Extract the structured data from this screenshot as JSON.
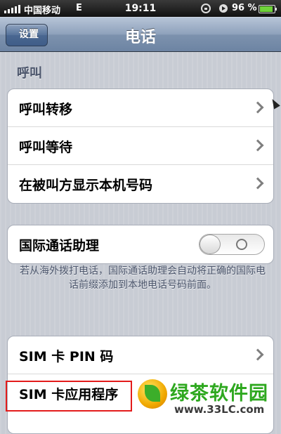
{
  "status_bar": {
    "carrier": "中国移动",
    "network": "E",
    "time": "19:11",
    "battery": "96 %"
  },
  "nav": {
    "back_label": "设置",
    "title": "电话"
  },
  "call_section": {
    "header": "呼叫",
    "items": [
      {
        "label": "呼叫转移"
      },
      {
        "label": "呼叫等待"
      },
      {
        "label": "在被叫方显示本机号码"
      }
    ]
  },
  "intl_assist": {
    "label": "国际通话助理",
    "toggle_on": false,
    "note": "若从海外拨打电话，国际通话助理会自动将正确的国际电话前缀添加到本地电话号码前面。"
  },
  "sim_section": {
    "items": [
      {
        "label": "SIM 卡 PIN 码"
      },
      {
        "label": "SIM 卡应用程序"
      }
    ]
  },
  "watermark": {
    "name": "绿茶软件园",
    "url": "www.33LC.com"
  },
  "colors": {
    "highlight": "#e31b1b",
    "nav_blue": "#6d84a3"
  }
}
